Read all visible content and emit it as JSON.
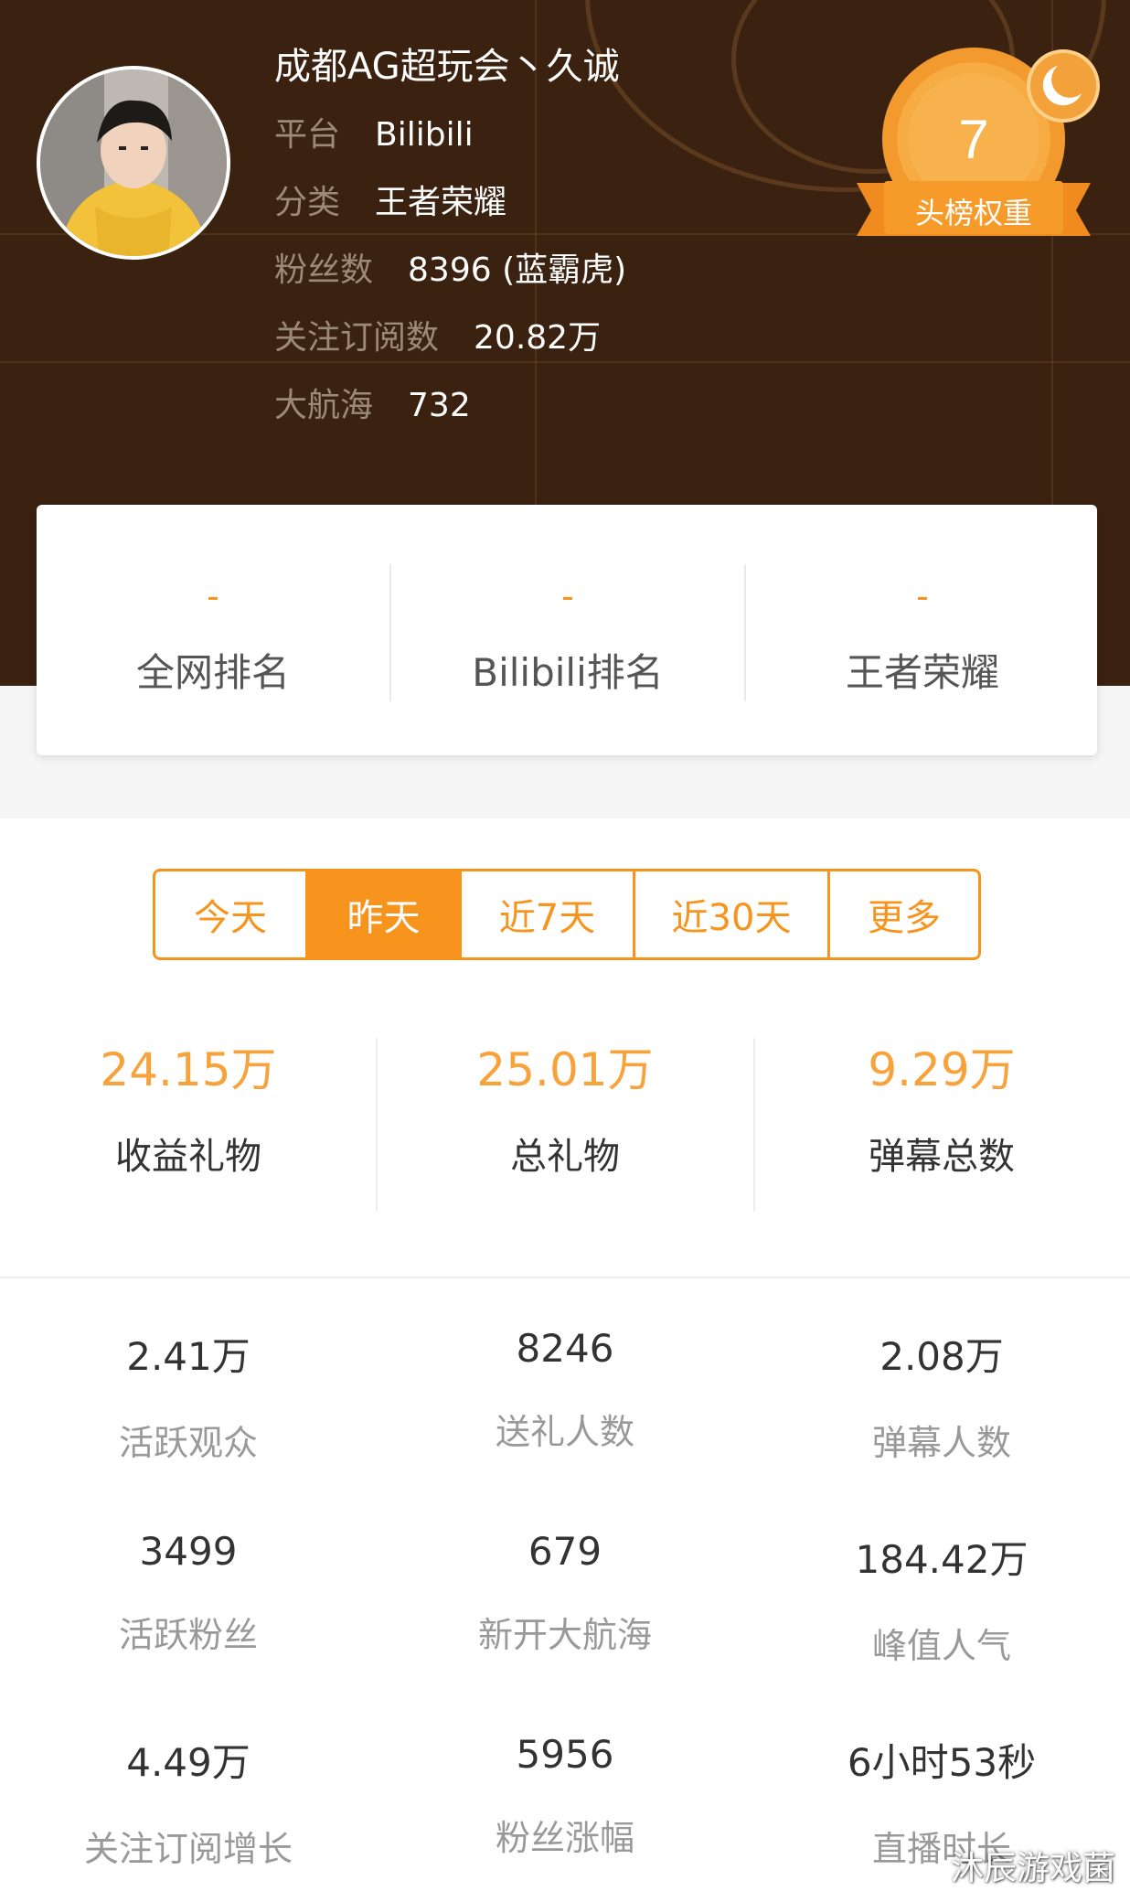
{
  "streamer": {
    "name": "成都AG超玩会丶久诚",
    "info": [
      {
        "label": "平台",
        "value": "Bilibili"
      },
      {
        "label": "分类",
        "value": "王者荣耀"
      },
      {
        "label": "粉丝数",
        "value": "8396 (蓝霸虎)"
      },
      {
        "label": "关注订阅数",
        "value": "20.82万"
      },
      {
        "label": "大航海",
        "value": "732"
      }
    ]
  },
  "badge": {
    "number": "7",
    "label": "头榜权重"
  },
  "ranks": [
    {
      "value": "-",
      "label": "全网排名"
    },
    {
      "value": "-",
      "label": "Bilibili排名"
    },
    {
      "value": "-",
      "label": "王者荣耀"
    }
  ],
  "tabs": [
    {
      "label": "今天",
      "active": false
    },
    {
      "label": "昨天",
      "active": true
    },
    {
      "label": "近7天",
      "active": false
    },
    {
      "label": "近30天",
      "active": false
    },
    {
      "label": "更多",
      "active": false
    }
  ],
  "highlights": [
    {
      "value": "24.15万",
      "label": "收益礼物"
    },
    {
      "value": "25.01万",
      "label": "总礼物"
    },
    {
      "value": "9.29万",
      "label": "弹幕总数"
    }
  ],
  "stats": [
    {
      "value": "2.41万",
      "label": "活跃观众"
    },
    {
      "value": "8246",
      "label": "送礼人数"
    },
    {
      "value": "2.08万",
      "label": "弹幕人数"
    },
    {
      "value": "3499",
      "label": "活跃粉丝"
    },
    {
      "value": "679",
      "label": "新开大航海"
    },
    {
      "value": "184.42万",
      "label": "峰值人气"
    },
    {
      "value": "4.49万",
      "label": "关注订阅增长"
    },
    {
      "value": "5956",
      "label": "粉丝涨幅"
    },
    {
      "value": "6小时53秒",
      "label": "直播时长"
    }
  ],
  "watermark": "沐辰游戏菌",
  "colors": {
    "accent": "#f7941d",
    "header_bg": "#3b2210",
    "highlight_value": "#f7a23a"
  }
}
